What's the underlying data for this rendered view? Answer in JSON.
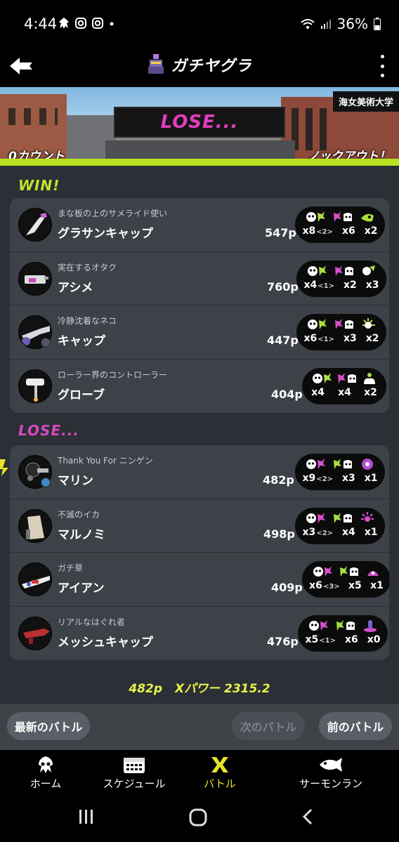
{
  "status": {
    "time": "4:44",
    "battery": "36%"
  },
  "header": {
    "title": "ガチヤグラ"
  },
  "banner": {
    "stage": "海女美術大学",
    "result": "LOSE...",
    "left_count": "0カウント",
    "right_count": "ノックアウト！"
  },
  "win_heading": "WIN!",
  "lose_heading": "LOSE...",
  "win_players": [
    {
      "byname": "まな板の上のサメライド使い",
      "name": "グラサンキャップ",
      "points": "547p",
      "kills": "x8",
      "assists": "<2>",
      "deaths": "x6",
      "specials": "x2"
    },
    {
      "byname": "実在するオタク",
      "name": "アシメ",
      "points": "760p",
      "kills": "x4",
      "assists": "<1>",
      "deaths": "x2",
      "specials": "x3"
    },
    {
      "byname": "冷静沈着なネコ",
      "name": "キャップ",
      "points": "447p",
      "kills": "x6",
      "assists": "<1>",
      "deaths": "x3",
      "specials": "x2"
    },
    {
      "byname": "ローラー界のコントローラー",
      "name": "グローブ",
      "points": "404p",
      "kills": "x4",
      "assists": "",
      "deaths": "x4",
      "specials": "x2"
    }
  ],
  "lose_players": [
    {
      "byname": "Thank You For ニンゲン",
      "name": "マリン",
      "points": "482p",
      "kills": "x9",
      "assists": "<2>",
      "deaths": "x3",
      "specials": "x1"
    },
    {
      "byname": "不滅のイカ",
      "name": "マルノミ",
      "points": "498p",
      "kills": "x3",
      "assists": "<2>",
      "deaths": "x4",
      "specials": "x1"
    },
    {
      "byname": "ガチ草",
      "name": "アイアン",
      "points": "409p",
      "kills": "x6",
      "assists": "<3>",
      "deaths": "x5",
      "specials": "x1"
    },
    {
      "byname": "リアルなはぐれ者",
      "name": "メッシュキャップ",
      "points": "476p",
      "kills": "x5",
      "assists": "<1>",
      "deaths": "x6",
      "specials": "x0"
    }
  ],
  "summary": {
    "points": "482p",
    "xpower": "Xパワー 2315.2"
  },
  "buttons": {
    "latest": "最新のバトル",
    "next": "次のバトル",
    "prev": "前のバトル"
  },
  "nav": [
    {
      "label": "ホーム",
      "icon": "squid-icon"
    },
    {
      "label": "スケジュール",
      "icon": "calendar-icon"
    },
    {
      "label": "バトル",
      "icon": "battle-icon"
    },
    {
      "label": "サーモンラン",
      "icon": "salmon-icon"
    }
  ],
  "colors": {
    "win": "#bfe52a",
    "lose": "#d44bc4",
    "accent": "#e9e327",
    "bar": "#b7e320"
  }
}
